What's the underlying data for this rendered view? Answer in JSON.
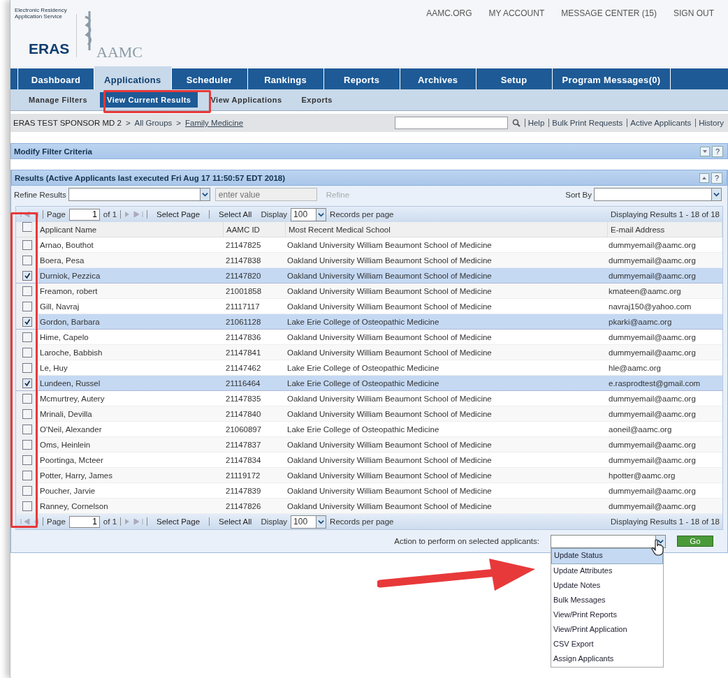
{
  "header": {
    "logo_subtitle": "Electronic Residency Application Service",
    "logo_title": "ERAS",
    "org_name": "AAMC",
    "top_links": [
      "AAMC.ORG",
      "MY ACCOUNT",
      "MESSAGE CENTER (15)",
      "SIGN OUT"
    ]
  },
  "tabs": [
    {
      "label": "Dashboard",
      "selected": false
    },
    {
      "label": "Applications",
      "selected": true
    },
    {
      "label": "Scheduler",
      "selected": false
    },
    {
      "label": "Rankings",
      "selected": false
    },
    {
      "label": "Reports",
      "selected": false
    },
    {
      "label": "Archives",
      "selected": false
    },
    {
      "label": "Setup",
      "selected": false
    },
    {
      "label": "Program Messages(0)",
      "selected": false
    }
  ],
  "subtabs": [
    {
      "label": "Manage Filters",
      "selected": false
    },
    {
      "label": "View Current Results",
      "selected": true
    },
    {
      "label": "View Applications",
      "selected": false
    },
    {
      "label": "Exports",
      "selected": false
    }
  ],
  "breadcrumb": {
    "sponsor": "ERAS TEST SPONSOR MD 2",
    "separator": ">",
    "group": "All Groups",
    "program": "Family Medicine"
  },
  "quick_links": [
    "Help",
    "Bulk Print Requests",
    "Active Applicants",
    "History"
  ],
  "filter_panel": {
    "title": "Modify Filter Criteria",
    "help": "?"
  },
  "results_panel": {
    "title": "Results (Active Applicants last executed Fri Aug 17 11:50:57 EDT 2018)",
    "help": "?",
    "refine_label": "Refine Results",
    "value_placeholder": "enter value",
    "refine_button": "Refine",
    "sort_label": "Sort By",
    "pagers": [
      {
        "page_label": "Page",
        "page": "1",
        "of": "of 1",
        "select_page": "Select Page",
        "select_all": "Select All",
        "display_label": "Display",
        "per_page": "100",
        "records_label": "Records per page",
        "summary": "Displaying Results 1 - 18 of 18"
      },
      {
        "page_label": "Page",
        "page": "1",
        "of": "of 1",
        "select_page": "Select Page",
        "select_all": "Select All",
        "display_label": "Display",
        "per_page": "100",
        "records_label": "Records per page",
        "summary": "Displaying Results 1 - 18 of 18"
      }
    ]
  },
  "table": {
    "columns": [
      "Applicant Name",
      "AAMC ID",
      "Most Recent Medical School",
      "E-mail Address"
    ],
    "header_checked": false,
    "rows": [
      {
        "name": "Arnao, Bouthot",
        "id": "21147825",
        "school": "Oakland University William Beaumont School of Medicine",
        "email": "dummyemail@aamc.org",
        "checked": false
      },
      {
        "name": "Boera, Pesa",
        "id": "21147838",
        "school": "Oakland University William Beaumont School of Medicine",
        "email": "dummyemail@aamc.org",
        "checked": false
      },
      {
        "name": "Durniok, Pezzica",
        "id": "21147820",
        "school": "Oakland University William Beaumont School of Medicine",
        "email": "dummyemail@aamc.org",
        "checked": true
      },
      {
        "name": "Freamon, robert",
        "id": "21001858",
        "school": "Oakland University William Beaumont School of Medicine",
        "email": "kmateen@aamc.org",
        "checked": false
      },
      {
        "name": "Gill, Navraj",
        "id": "21117117",
        "school": "Oakland University William Beaumont School of Medicine",
        "email": "navraj150@yahoo.com",
        "checked": false
      },
      {
        "name": "Gordon, Barbara",
        "id": "21061128",
        "school": "Lake Erie College of Osteopathic Medicine",
        "email": "pkarki@aamc.org",
        "checked": true
      },
      {
        "name": "Hime, Capelo",
        "id": "21147836",
        "school": "Oakland University William Beaumont School of Medicine",
        "email": "dummyemail@aamc.org",
        "checked": false
      },
      {
        "name": "Laroche, Babbish",
        "id": "21147841",
        "school": "Oakland University William Beaumont School of Medicine",
        "email": "dummyemail@aamc.org",
        "checked": false
      },
      {
        "name": "Le, Huy",
        "id": "21147462",
        "school": "Lake Erie College of Osteopathic Medicine",
        "email": "hle@aamc.org",
        "checked": false
      },
      {
        "name": "Lundeen, Russel",
        "id": "21116464",
        "school": "Lake Erie College of Osteopathic Medicine",
        "email": "e.rasprodtest@gmail.com",
        "checked": true
      },
      {
        "name": "Mcmurtrey, Autery",
        "id": "21147835",
        "school": "Oakland University William Beaumont School of Medicine",
        "email": "dummyemail@aamc.org",
        "checked": false
      },
      {
        "name": "Mrinali, Devilla",
        "id": "21147840",
        "school": "Oakland University William Beaumont School of Medicine",
        "email": "dummyemail@aamc.org",
        "checked": false
      },
      {
        "name": "O'Neil, Alexander",
        "id": "21060897",
        "school": "Lake Erie College of Osteopathic Medicine",
        "email": "aoneil@aamc.org",
        "checked": false
      },
      {
        "name": "Oms, Heinlein",
        "id": "21147837",
        "school": "Oakland University William Beaumont School of Medicine",
        "email": "dummyemail@aamc.org",
        "checked": false
      },
      {
        "name": "Poortinga, Mcteer",
        "id": "21147834",
        "school": "Oakland University William Beaumont School of Medicine",
        "email": "dummyemail@aamc.org",
        "checked": false
      },
      {
        "name": "Potter, Harry, James",
        "id": "21119172",
        "school": "Oakland University William Beaumont School of Medicine",
        "email": "hpotter@aamc.org",
        "checked": false
      },
      {
        "name": "Poucher, Jarvie",
        "id": "21147839",
        "school": "Oakland University William Beaumont School of Medicine",
        "email": "dummyemail@aamc.org",
        "checked": false
      },
      {
        "name": "Ranney, Cornelson",
        "id": "21147826",
        "school": "Oakland University William Beaumont School of Medicine",
        "email": "dummyemail@aamc.org",
        "checked": false
      }
    ]
  },
  "action": {
    "label": "Action to perform on selected applicants:",
    "go": "Go",
    "options": [
      {
        "label": "Update Status",
        "selected": true
      },
      {
        "label": "Update Attributes",
        "selected": false
      },
      {
        "label": "Update Notes",
        "selected": false
      },
      {
        "label": "Bulk Messages",
        "selected": false
      },
      {
        "label": "View/Print Reports",
        "selected": false
      },
      {
        "label": "View/Print Application",
        "selected": false
      },
      {
        "label": "CSV Export",
        "selected": false
      },
      {
        "label": "Assign Applicants",
        "selected": false
      }
    ]
  }
}
